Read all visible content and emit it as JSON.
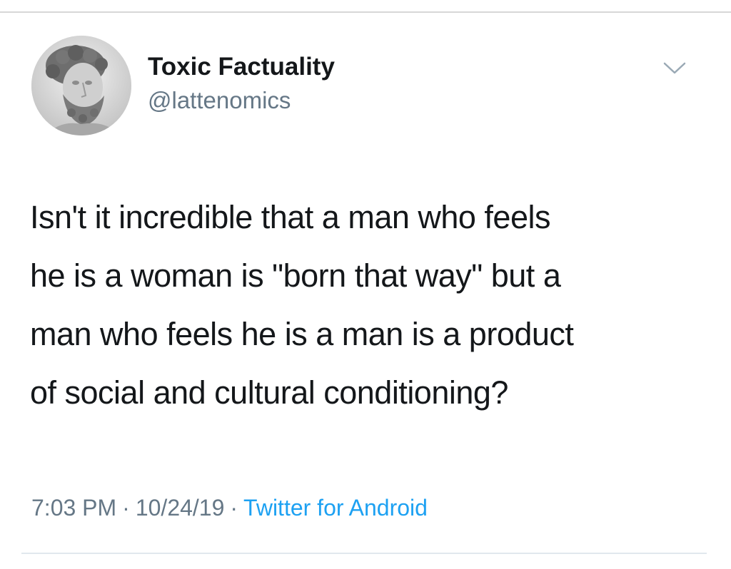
{
  "tweet": {
    "author": {
      "name": "Toxic Factuality",
      "handle": "@lattenomics",
      "avatar_icon": "bust-statue-avatar"
    },
    "text_lines": [
      "Isn't it incredible that a man who feels",
      "he is a woman is \"born that way\" but a",
      "man who feels he is a man is a product",
      "of social and cultural conditioning?"
    ],
    "time": "7:03 PM",
    "date": "10/24/19",
    "separator": "·",
    "source": "Twitter for Android",
    "menu_icon": "chevron-down-icon"
  },
  "colors": {
    "text_primary": "#14171a",
    "text_secondary": "#657786",
    "link": "#1da1f2",
    "divider": "#e1e8ed"
  }
}
